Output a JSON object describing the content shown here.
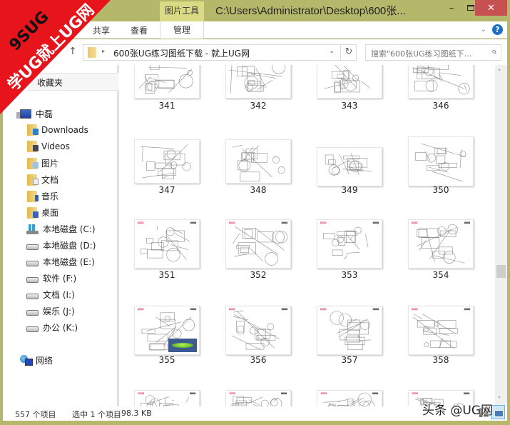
{
  "window": {
    "title": "C:\\Users\\Administrator\\Desktop\\600张...",
    "contextual_tab": "图片工具",
    "controls": {
      "minimize": "–",
      "maximize": "□",
      "close": "✕"
    }
  },
  "ribbon": {
    "tabs": [
      {
        "label": "共享"
      },
      {
        "label": "查看"
      },
      {
        "label": "管理",
        "active": true
      }
    ],
    "expand_icon": "⌄",
    "help_icon": "?"
  },
  "address_bar": {
    "up_icon": "↑",
    "separator_icon": "▸",
    "path": "600张UG练习图纸下载 - 就上UG网",
    "dropdown_icon": "⌄",
    "refresh_icon": "↻"
  },
  "search": {
    "placeholder": "搜索\"600张UG练习图纸下...",
    "icon": "⌕"
  },
  "nav": {
    "favorites": "收藏夹",
    "computer": "中磊",
    "items": [
      {
        "label": "Downloads",
        "icon": "downloads-folder"
      },
      {
        "label": "Videos",
        "icon": "videos-folder"
      },
      {
        "label": "图片",
        "icon": "pictures-folder"
      },
      {
        "label": "文档",
        "icon": "documents-folder"
      },
      {
        "label": "音乐",
        "icon": "music-folder"
      },
      {
        "label": "桌面",
        "icon": "desktop-folder"
      },
      {
        "label": "本地磁盘 (C:)",
        "icon": "system-drive"
      },
      {
        "label": "本地磁盘 (D:)",
        "icon": "drive"
      },
      {
        "label": "本地磁盘 (E:)",
        "icon": "drive"
      },
      {
        "label": "软件 (F:)",
        "icon": "drive"
      },
      {
        "label": "文档 (I:)",
        "icon": "drive"
      },
      {
        "label": "娱乐 (J:)",
        "icon": "drive"
      },
      {
        "label": "办公 (K:)",
        "icon": "drive"
      }
    ],
    "network": "网络"
  },
  "files": [
    {
      "name": "341"
    },
    {
      "name": "342"
    },
    {
      "name": "343"
    },
    {
      "name": "346"
    },
    {
      "name": "347"
    },
    {
      "name": "348"
    },
    {
      "name": "349"
    },
    {
      "name": "350"
    },
    {
      "name": "351"
    },
    {
      "name": "352"
    },
    {
      "name": "353"
    },
    {
      "name": "354"
    },
    {
      "name": "355"
    },
    {
      "name": "356"
    },
    {
      "name": "357"
    },
    {
      "name": "358"
    },
    {
      "name": ""
    },
    {
      "name": ""
    },
    {
      "name": ""
    },
    {
      "name": ""
    }
  ],
  "status": {
    "item_count": "557 个项目",
    "selected": "选中 1 个项目",
    "selected_size": "98.3 KB"
  },
  "scrollbar": {
    "up": "˄",
    "down": "˅",
    "position_fraction": 0.62
  },
  "watermarks": {
    "corner_line1": "9SUG",
    "corner_line2": "学UG就上UG网",
    "corner_color": "#e8141b",
    "bottom": "头条 @UG网"
  },
  "colors": {
    "frame": "#b5b86a",
    "contextual_tab": "#dcdb85",
    "close_button": "#c75050"
  }
}
